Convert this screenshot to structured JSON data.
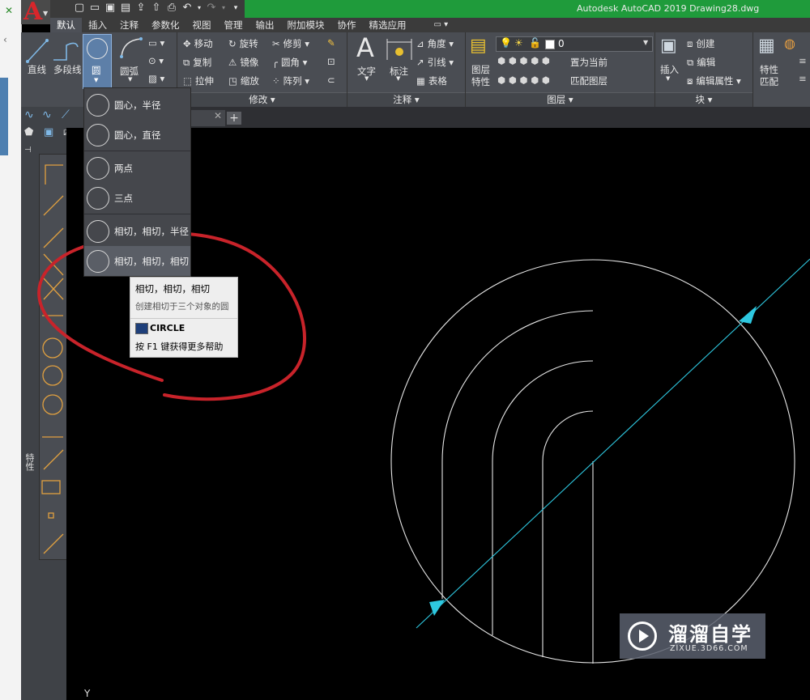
{
  "app": {
    "logo_letter": "A",
    "title": "Autodesk AutoCAD 2019    Drawing28.dwg"
  },
  "tabs": [
    "默认",
    "插入",
    "注释",
    "参数化",
    "视图",
    "管理",
    "输出",
    "附加模块",
    "协作",
    "精选应用"
  ],
  "ribbon": {
    "draw": {
      "line": "直线",
      "polyline": "多段线",
      "circle": "圆",
      "arc": "圆弧"
    },
    "modify": {
      "move": "移动",
      "rotate": "旋转",
      "trim": "修剪",
      "copy": "复制",
      "mirror": "镜像",
      "fillet": "圆角",
      "stretch": "拉伸",
      "scale": "缩放",
      "array": "阵列",
      "panel_label": "修改 ▾"
    },
    "annotation": {
      "text": "文字",
      "dimension": "标注",
      "angle": "角度",
      "leader": "引线",
      "table": "表格",
      "panel_label": "注释 ▾"
    },
    "layers": {
      "properties_line1": "图层",
      "properties_line2": "特性",
      "layer_value": "0",
      "set_current": "置为当前",
      "match_layer": "匹配图层",
      "panel_label": "图层 ▾"
    },
    "block": {
      "insert": "插入",
      "create": "创建",
      "edit": "编辑",
      "edit_attributes": "编辑属性",
      "panel_label": "块 ▾"
    },
    "properties": {
      "match_line1": "特性",
      "match_line2": "匹配"
    }
  },
  "circle_menu": {
    "items": [
      "圆心，半径",
      "圆心，直径",
      "两点",
      "三点",
      "相切，相切，半径",
      "相切，相切，相切"
    ]
  },
  "tooltip": {
    "title": "相切，相切，相切",
    "description": "创建相切于三个对象的圆",
    "command": "CIRCLE",
    "help": "按 F1 键获得更多帮助"
  },
  "palette": {
    "properties_tab": "特性"
  },
  "canvas": {
    "ucs_y_label": "Y"
  },
  "watermark": {
    "brand": "溜溜自学",
    "site": "ZIXUE.3D66.COM"
  },
  "colors": {
    "ribbon_bg": "#4a4d53",
    "title_green": "#1f9b3b",
    "canvas_bg": "#000000",
    "cad_line_white": "#e6e6e6",
    "cad_line_cyan": "#2ec8e0",
    "annotation_red": "#c8232a"
  }
}
